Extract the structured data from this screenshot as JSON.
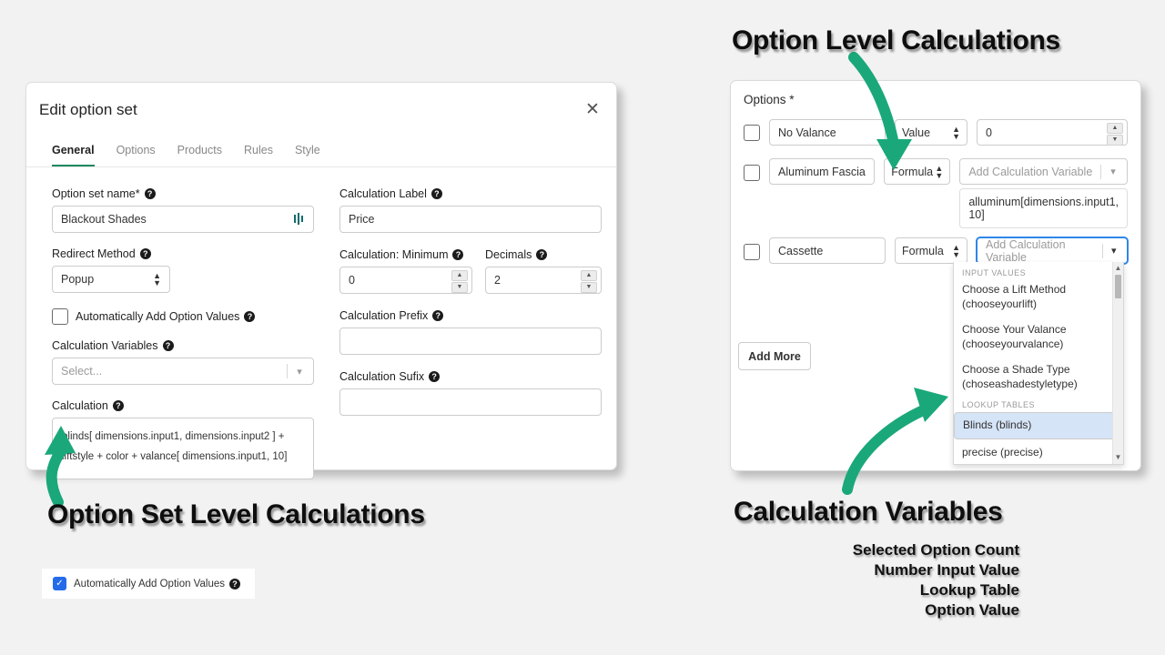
{
  "dialog": {
    "title": "Edit option set",
    "close_icon": "close-icon",
    "tabs": [
      {
        "label": "General",
        "active": true
      },
      {
        "label": "Options",
        "active": false
      },
      {
        "label": "Products",
        "active": false
      },
      {
        "label": "Rules",
        "active": false
      },
      {
        "label": "Style",
        "active": false
      }
    ],
    "left_column": {
      "option_set_name_label": "Option set name*",
      "option_set_name_value": "Blackout Shades",
      "redirect_method_label": "Redirect Method",
      "redirect_method_value": "Popup",
      "auto_add_label": "Automatically Add Option Values",
      "calc_vars_label": "Calculation Variables",
      "calc_vars_placeholder": "Select...",
      "calculation_label": "Calculation",
      "calculation_line1": "blinds[ dimensions.input1, dimensions.input2 ]  +",
      "calculation_line2": "liftstyle + color +  valance[  dimensions.input1, 10]"
    },
    "right_column": {
      "calc_label_label": "Calculation Label",
      "calc_label_value": "Price",
      "calc_min_label": "Calculation: Minimum",
      "calc_min_value": "0",
      "decimals_label": "Decimals",
      "decimals_value": "2",
      "calc_prefix_label": "Calculation Prefix",
      "calc_prefix_value": "",
      "calc_suffix_label": "Calculation Sufix",
      "calc_suffix_value": ""
    }
  },
  "options_panel": {
    "title": "Options *",
    "add_more_label": "Add More",
    "rows": [
      {
        "name": "No Valance",
        "type": "Value",
        "value": "0",
        "value_kind": "number"
      },
      {
        "name": "Aluminum Fascia",
        "type": "Formula",
        "value_placeholder": "Add Calculation Variable",
        "value_kind": "formula",
        "formula": "alluminum[dimensions.input1, 10]"
      },
      {
        "name": "Cassette",
        "type": "Formula",
        "value_placeholder": "Add Calculation Variable",
        "value_kind": "formula-open"
      }
    ]
  },
  "dropdown": {
    "groups": [
      {
        "heading": "INPUT VALUES",
        "items": [
          {
            "label": "Choose a Lift Method (chooseyourlift)",
            "selected": false
          },
          {
            "label": "Choose Your Valance (chooseyourvalance)",
            "selected": false
          },
          {
            "label": "Choose a Shade Type (choseashadestyletype)",
            "selected": false
          }
        ]
      },
      {
        "heading": "LOOKUP TABLES",
        "items": [
          {
            "label": "Blinds (blinds)",
            "selected": true
          },
          {
            "label": "precise (precise)",
            "selected": false
          }
        ]
      }
    ]
  },
  "annotations": {
    "option_level": "Option Level Calculations",
    "option_set_level": "Option Set Level Calculations",
    "calculation_variables": "Calculation Variables",
    "variable_kinds": [
      "Selected Option Count",
      "Number Input Value",
      "Lookup Table",
      "Option Value"
    ]
  },
  "floating_checkbox": {
    "label": "Automatically Add Option Values",
    "checked": true,
    "check_glyph": "✓"
  },
  "colors": {
    "accent_green": "#1aa87a",
    "tab_underline": "#1f8a5f",
    "focus_blue": "#2e86e8",
    "selected_row": "#d6e4f7",
    "checkbox_blue": "#246bea",
    "background": "#f2f2f2"
  }
}
